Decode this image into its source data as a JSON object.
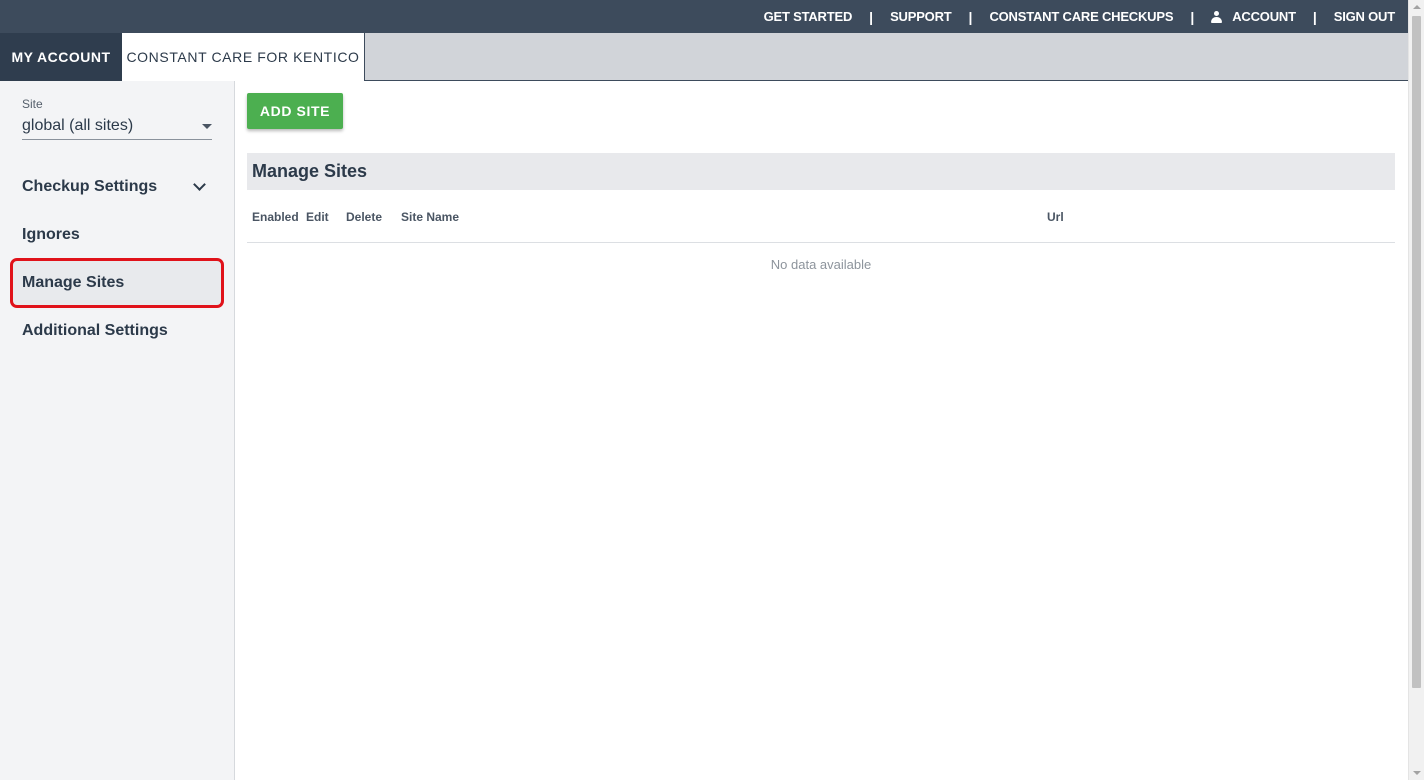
{
  "topnav": {
    "get_started": "GET STARTED",
    "support": "SUPPORT",
    "checkups": "CONSTANT CARE CHECKUPS",
    "account": "ACCOUNT",
    "sign_out": "SIGN OUT",
    "separator": "|"
  },
  "tabs": [
    {
      "label": "MY ACCOUNT",
      "active": false
    },
    {
      "label": "CONSTANT CARE FOR KENTICO",
      "active": true
    }
  ],
  "sidebar": {
    "site_select": {
      "label": "Site",
      "value": "global (all sites)"
    },
    "items": [
      {
        "label": "Checkup Settings",
        "expandable": true
      },
      {
        "label": "Ignores"
      },
      {
        "label": "Manage Sites",
        "selected": true
      },
      {
        "label": "Additional Settings"
      }
    ]
  },
  "main": {
    "add_button": "ADD SITE",
    "section_title": "Manage Sites",
    "table": {
      "columns": [
        "Enabled",
        "Edit",
        "Delete",
        "Site Name",
        "Url"
      ],
      "empty_message": "No data available"
    }
  },
  "colors": {
    "topbar": "#3d4b5c",
    "accent_green": "#4caf50",
    "highlight_red": "#e0121a"
  }
}
